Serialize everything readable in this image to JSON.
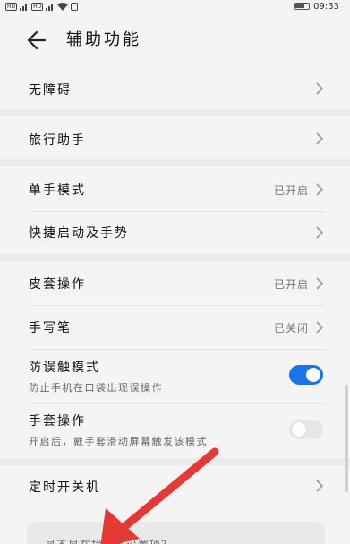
{
  "status_bar": {
    "left_badges": [
      "HD",
      "HD"
    ],
    "time": "09:33",
    "battery_icon": "battery-icon"
  },
  "header": {
    "title": "辅助功能",
    "back_icon": "back-arrow-icon"
  },
  "sections": {
    "accessibility": {
      "label": "无障碍"
    },
    "travel_assistant": {
      "label": "旅行助手"
    },
    "one_handed_mode": {
      "label": "单手模式",
      "value": "已开启"
    },
    "shortcuts_gestures": {
      "label": "快捷启动及手势"
    },
    "holster_operation": {
      "label": "皮套操作",
      "value": "已开启"
    },
    "handwriting_pen": {
      "label": "手写笔",
      "value": "已关闭"
    },
    "accidental_touch": {
      "label": "防误触模式",
      "desc": "防止手机在口袋出现误操作",
      "enabled": true
    },
    "glove_mode": {
      "label": "手套操作",
      "desc": "开启后，戴手套滑动屏幕触发该模式",
      "enabled": false
    },
    "scheduled_power": {
      "label": "定时开关机"
    }
  },
  "card": {
    "text": "是不是在找其他设置项？"
  },
  "colors": {
    "accent": "#1a73e8",
    "annotation_arrow": "#e53935",
    "background": "#f4f4f4"
  }
}
